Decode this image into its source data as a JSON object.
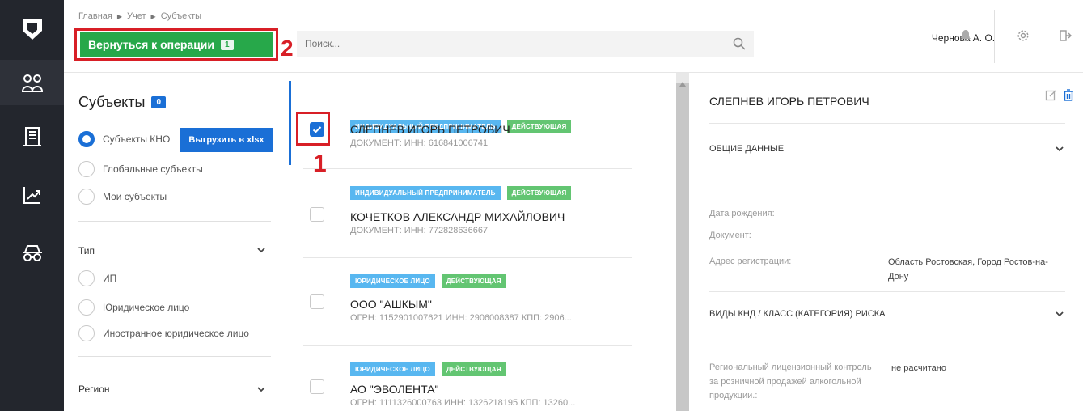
{
  "breadcrumb": [
    "Главная",
    "Учет",
    "Субъекты"
  ],
  "header": {
    "back_label": "Вернуться к операции",
    "back_count": "1",
    "search_placeholder": "Поиск...",
    "user_name": "Чернова А. О."
  },
  "annotations": {
    "step1": "1",
    "step2": "2"
  },
  "filters": {
    "title": "Субъекты",
    "count": "0",
    "radios": [
      "Субъекты КНО",
      "Глобальные субъекты",
      "Мои субъекты"
    ],
    "export_label": "Выгрузить в xlsx",
    "type_title": "Тип",
    "type_options": [
      "ИП",
      "Юридическое лицо",
      "Иностранное юридическое лицо"
    ],
    "region_title": "Регион"
  },
  "subjects": [
    {
      "tags": [
        "ИНДИВИДУАЛЬНЫЙ ПРЕДПРИНИМАТЕЛЬ",
        "ДЕЙСТВУЮЩАЯ"
      ],
      "name": "СЛЕПНЕВ ИГОРЬ ПЕТРОВИЧ",
      "doc": "ДОКУМЕНТ: ИНН: 616841006741",
      "checked": true
    },
    {
      "tags": [
        "ИНДИВИДУАЛЬНЫЙ ПРЕДПРИНИМАТЕЛЬ",
        "ДЕЙСТВУЮЩАЯ"
      ],
      "name": "КОЧЕТКОВ АЛЕКСАНДР МИХАЙЛОВИЧ",
      "doc": "ДОКУМЕНТ: ИНН: 772828636667",
      "checked": false
    },
    {
      "tags": [
        "ЮРИДИЧЕСКОЕ ЛИЦО",
        "ДЕЙСТВУЮЩАЯ"
      ],
      "name": "ООО \"АШКЫМ\"",
      "doc": "ОГРН: 1152901007621   ИНН: 2906008387   КПП: 2906...",
      "checked": false
    },
    {
      "tags": [
        "ЮРИДИЧЕСКОЕ ЛИЦО",
        "ДЕЙСТВУЮЩАЯ"
      ],
      "name": "АО \"ЭВОЛЕНТА\"",
      "doc": "ОГРН: 1111326000763   ИНН: 1326218195   КПП: 13260...",
      "checked": false
    }
  ],
  "detail": {
    "title": "СЛЕПНЕВ ИГОРЬ ПЕТРОВИЧ",
    "general_section": "ОБЩИЕ ДАННЫЕ",
    "birth_label": "Дата рождения:",
    "document_label": "Документ:",
    "address_label": "Адрес регистрации:",
    "address_value": "Область Ростовская, Город Ростов-на-Дону",
    "risk_section": "ВИДЫ КНД / КЛАСС (КАТЕГОРИЯ) РИСКА",
    "risk_label": "Региональный лицензионный контроль за розничной продажей алкогольной продукции.:",
    "risk_value": "не расчитано"
  },
  "colors": {
    "rail": "#23262d",
    "accent_green": "#27a84a",
    "accent_blue": "#1a6fd6",
    "annotation_red": "#d81f26",
    "tag_blue": "#58b7f0",
    "tag_green": "#63c572"
  },
  "icons": {
    "rail": [
      "logo-shield-icon",
      "users-icon",
      "building-icon",
      "chart-trend-icon",
      "car-icon"
    ],
    "header": [
      "search-icon",
      "bell-icon",
      "gear-icon",
      "logout-icon"
    ],
    "detail": [
      "edit-icon",
      "trash-icon"
    ]
  }
}
